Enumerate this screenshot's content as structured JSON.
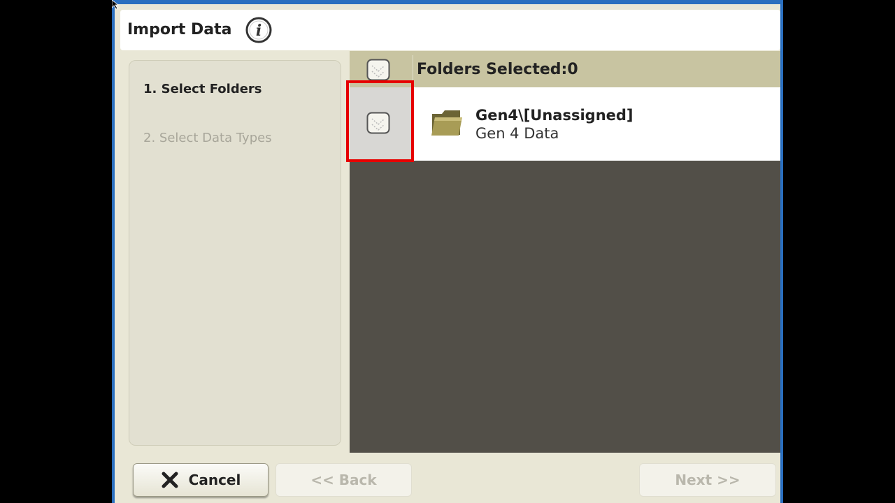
{
  "dialog": {
    "title": "Import Data",
    "info_icon": "info-icon"
  },
  "steps": [
    {
      "label": "1. Select Folders",
      "active": true
    },
    {
      "label": "2. Select Data Types",
      "active": false
    }
  ],
  "list": {
    "header": "Folders Selected:0",
    "rows": [
      {
        "title": "Gen4\\[Unassigned]",
        "subtitle": "Gen 4 Data",
        "icon": "folder-icon",
        "checked": false
      }
    ]
  },
  "footer": {
    "cancel_label": "Cancel",
    "back_label": "<< Back",
    "next_label": "Next >>"
  },
  "colors": {
    "highlight": "#e60000",
    "header_bg": "#c8c4a1",
    "list_bg": "#524f48",
    "window_border": "#2a6fbf"
  }
}
